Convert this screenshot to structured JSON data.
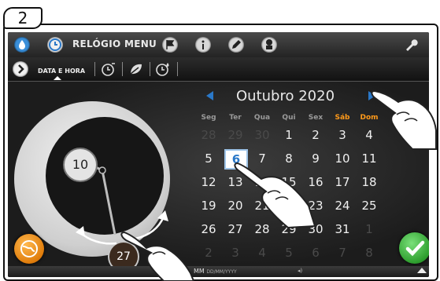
{
  "step_badge": "2",
  "topbar": {
    "title": "RELÓGIO MENU",
    "icons": [
      "water-drop-icon",
      "clock-icon",
      "flag-icon",
      "info-icon",
      "pencil-icon",
      "chef-icon",
      "wrench-icon"
    ]
  },
  "tabbar": {
    "active_tab_label": "DATA E HORA",
    "tabs": [
      "arrow-right-icon",
      "timer-icon",
      "leaf-icon",
      "clock-drop-icon"
    ]
  },
  "calendar": {
    "month_label": "Outubro 2020",
    "weekdays": [
      "Seg",
      "Ter",
      "Qua",
      "Qui",
      "Sex",
      "Sáb",
      "Dom"
    ],
    "weeks": [
      [
        "28",
        "29",
        "30",
        "1",
        "2",
        "3",
        "4"
      ],
      [
        "5",
        "6",
        "7",
        "8",
        "9",
        "10",
        "11"
      ],
      [
        "12",
        "13",
        "14",
        "15",
        "16",
        "17",
        "18"
      ],
      [
        "19",
        "20",
        "21",
        "22",
        "23",
        "24",
        "25"
      ],
      [
        "26",
        "27",
        "28",
        "29",
        "30",
        "31",
        "1"
      ],
      [
        "2",
        "3",
        "4",
        "5",
        "6",
        "7",
        "8"
      ]
    ],
    "selected_day": "6"
  },
  "clock": {
    "hour_value": "10",
    "minute_value": "27"
  },
  "statusbar": {
    "format_label": "MM",
    "format_small": "DD/MM/YYYY"
  },
  "colors": {
    "accent_blue": "#2a78c8",
    "weekend_orange": "#ff9a1a",
    "ok_green": "#2e9e2e",
    "globe_orange": "#e07d0c"
  }
}
